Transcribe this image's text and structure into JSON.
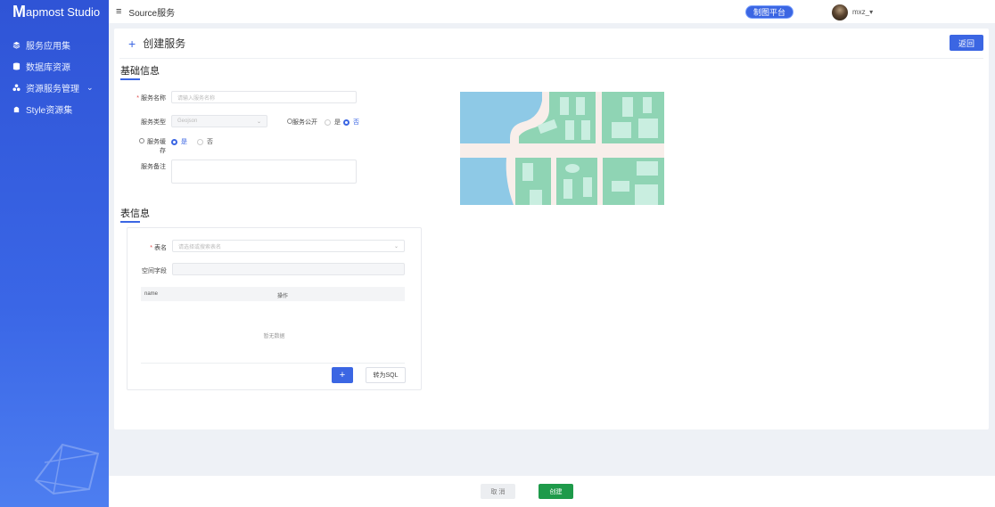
{
  "app": {
    "logo_mark": "M",
    "logo_text": "apmost Studio"
  },
  "sidebar": {
    "items": [
      {
        "label": "服务应用集",
        "icon": "layers-icon"
      },
      {
        "label": "数据库资源",
        "icon": "database-icon"
      },
      {
        "label": "资源服务管理",
        "icon": "cluster-icon",
        "expanded": true
      },
      {
        "label": "Style资源集",
        "icon": "style-icon"
      }
    ]
  },
  "header": {
    "menu_icon": "≡",
    "breadcrumb": "Source服务",
    "platform_button": "制图平台",
    "user_name": "mxz_▾"
  },
  "page": {
    "title": "创建服务",
    "back_button": "返回"
  },
  "basic": {
    "section_title": "基础信息",
    "name_label": "服务名称",
    "name_placeholder": "请输入服务名称",
    "type_label": "服务类型",
    "type_value": "Geojson",
    "public_label": "服务公开",
    "public_yes": "是",
    "public_no": "否",
    "cache_label": "服务缓存",
    "cache_yes": "是",
    "cache_no": "否",
    "remark_label": "服务备注"
  },
  "table_info": {
    "section_title": "表信息",
    "table_label": "表名",
    "table_placeholder": "请选择或搜索表名",
    "spatial_label": "空间字段",
    "col_name": "name",
    "col_action": "操作",
    "empty_text": "暂无数据",
    "add_button": "+",
    "sql_button": "转为SQL"
  },
  "footer": {
    "cancel_button": "取 消",
    "create_button": "创建"
  },
  "colors": {
    "primary": "#3b66e3",
    "success": "#1e9a4a",
    "map_water": "#8ec9e6",
    "map_green": "#8fd4b4",
    "map_road": "#f8eeea"
  }
}
